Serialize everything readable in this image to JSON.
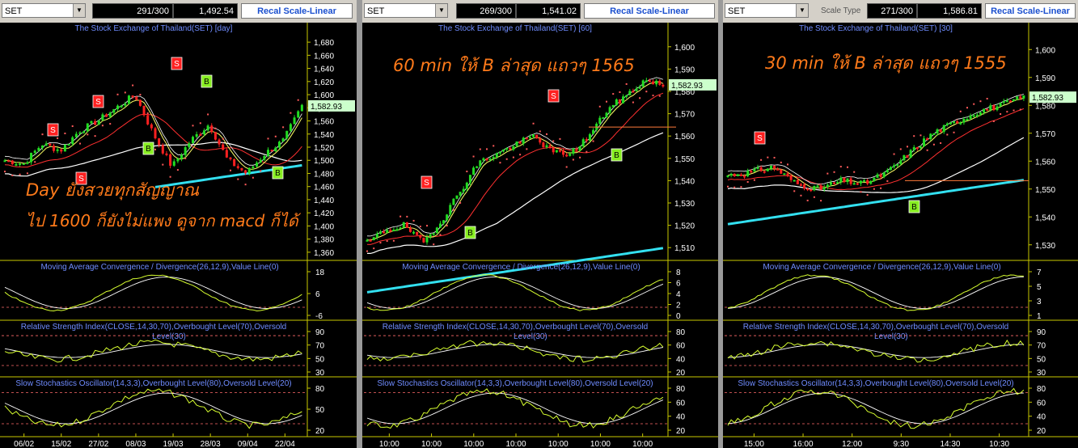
{
  "panels": [
    {
      "symbol": "SET",
      "bars": "291/300",
      "value": "1,492.54",
      "scale_label": "",
      "recal": "Recal Scale-Linear",
      "title": "The Stock Exchange of Thailand(SET) [day]",
      "last_price": "1,582.93",
      "price_ticks": [
        "1,680",
        "1,660",
        "1,640",
        "1,620",
        "1,600",
        "1,580",
        "1,560",
        "1,540",
        "1,520",
        "1,500",
        "1,480",
        "1,460",
        "1,440",
        "1,420",
        "1,400",
        "1,380",
        "1,360"
      ],
      "annotations": [
        "Day ยังสวยทุกสัญญาณ",
        "ไป 1600 ก็ยังไม่แพง ดูจาก macd ก็ได้"
      ],
      "macd_label": "Moving Average Convergence / Divergence(26,12,9),Value Line(0)",
      "macd_ticks": [
        "18",
        "6",
        "-6"
      ],
      "rsi_label_1": "Relative Strength Index(CLOSE,14,30,70),Overbought Level(70),Oversold",
      "rsi_label_2": "Level(30)",
      "rsi_ticks": [
        "90",
        "70",
        "50",
        "30"
      ],
      "stoch_label": "Slow Stochastics Oscillator(14,3,3),Overbought Level(80),Oversold Level(20)",
      "stoch_ticks": [
        "80",
        "50",
        "20"
      ],
      "x_ticks": [
        "06/02",
        "15/02",
        "27/02",
        "08/03",
        "19/03",
        "28/03",
        "09/04",
        "22/04"
      ],
      "signals": [
        "S",
        "S",
        "S",
        "B",
        "S",
        "B",
        "B"
      ]
    },
    {
      "symbol": "SET",
      "bars": "269/300",
      "value": "1,541.02",
      "scale_label": "",
      "recal": "Recal Scale-Linear",
      "title": "The Stock Exchange of Thailand(SET) [60]",
      "last_price": "1,582.93",
      "price_ticks": [
        "1,600",
        "1,590",
        "1,580",
        "1,570",
        "1,560",
        "1,550",
        "1,540",
        "1,530",
        "1,520",
        "1,510"
      ],
      "annotations": [
        "60 min ให้ B ล่าสุด แถวๆ 1565"
      ],
      "macd_label": "Moving Average Convergence / Divergence(26,12,9),Value Line(0)",
      "macd_ticks": [
        "8",
        "6",
        "4",
        "2",
        "0"
      ],
      "rsi_label_1": "Relative Strength Index(CLOSE,14,30,70),Overbought Level(70),Oversold",
      "rsi_label_2": "Level(30)",
      "rsi_ticks": [
        "80",
        "60",
        "40",
        "20"
      ],
      "stoch_label": "Slow Stochastics Oscillator(14,3,3),Overbought Level(80),Oversold Level(20)",
      "stoch_ticks": [
        "80",
        "60",
        "40",
        "20"
      ],
      "x_ticks": [
        "10:00",
        "10:00",
        "10:00",
        "10:00",
        "10:00",
        "10:00",
        "10:00"
      ],
      "signals": [
        "S",
        "B",
        "S",
        "B"
      ]
    },
    {
      "symbol": "SET",
      "bars": "271/300",
      "value": "1,586.81",
      "scale_label": "Scale Type",
      "recal": "Recal Scale-Linear",
      "title": "The Stock Exchange of Thailand(SET) [30]",
      "last_price": "1,582.93",
      "price_ticks": [
        "1,600",
        "1,590",
        "1,580",
        "1,570",
        "1,560",
        "1,550",
        "1,540",
        "1,530"
      ],
      "annotations": [
        "30 min ให้ B ล่าสุด แถวๆ 1555"
      ],
      "macd_label": "Moving Average Convergence / Divergence(26,12,9),Value Line(0)",
      "macd_ticks": [
        "7",
        "5",
        "3",
        "1"
      ],
      "rsi_label_1": "Relative Strength Index(CLOSE,14,30,70),Overbought Level(70),Oversold",
      "rsi_label_2": "Level(30)",
      "rsi_ticks": [
        "90",
        "70",
        "50",
        "30"
      ],
      "stoch_label": "Slow Stochastics Oscillator(14,3,3),Overbought Level(80),Oversold Level(20)",
      "stoch_ticks": [
        "80",
        "60",
        "40",
        "20"
      ],
      "x_ticks": [
        "15:00",
        "16:00",
        "12:00",
        "9:30",
        "14:30",
        "10:30"
      ],
      "signals": [
        "S",
        "B"
      ]
    }
  ],
  "colors": {
    "background": "#000000",
    "candle_up": "#22dd22",
    "candle_down": "#ff2020",
    "ma_fast": "#ffff66",
    "ma_white": "#ffffff",
    "ma_red": "#ff3030",
    "ma_cyan": "#33e0f0",
    "annotation": "#ff7a1a",
    "indicator_label": "#6f8cff",
    "sell_marker": "#ff2020",
    "buy_marker": "#88ee22"
  },
  "chart_data": [
    {
      "type": "candlestick",
      "title": "The Stock Exchange of Thailand(SET) [day]",
      "x": [
        "06/02",
        "15/02",
        "27/02",
        "08/03",
        "19/03",
        "28/03",
        "09/04",
        "22/04"
      ],
      "close_approx": [
        1500,
        1518,
        1540,
        1570,
        1495,
        1530,
        1485,
        1583
      ],
      "ylim": [
        1350,
        1690
      ],
      "last": 1582.93
    },
    {
      "type": "candlestick",
      "title": "The Stock Exchange of Thailand(SET) [60]",
      "x": [
        "10:00",
        "10:00",
        "10:00",
        "10:00",
        "10:00",
        "10:00",
        "10:00"
      ],
      "close_approx": [
        1512,
        1522,
        1548,
        1555,
        1552,
        1568,
        1583
      ],
      "ylim": [
        1505,
        1605
      ],
      "last": 1582.93
    },
    {
      "type": "candlestick",
      "title": "The Stock Exchange of Thailand(SET) [30]",
      "x": [
        "15:00",
        "16:00",
        "12:00",
        "9:30",
        "14:30",
        "10:30"
      ],
      "close_approx": [
        1555,
        1558,
        1553,
        1557,
        1572,
        1583
      ],
      "ylim": [
        1525,
        1605
      ],
      "last": 1582.93
    }
  ]
}
